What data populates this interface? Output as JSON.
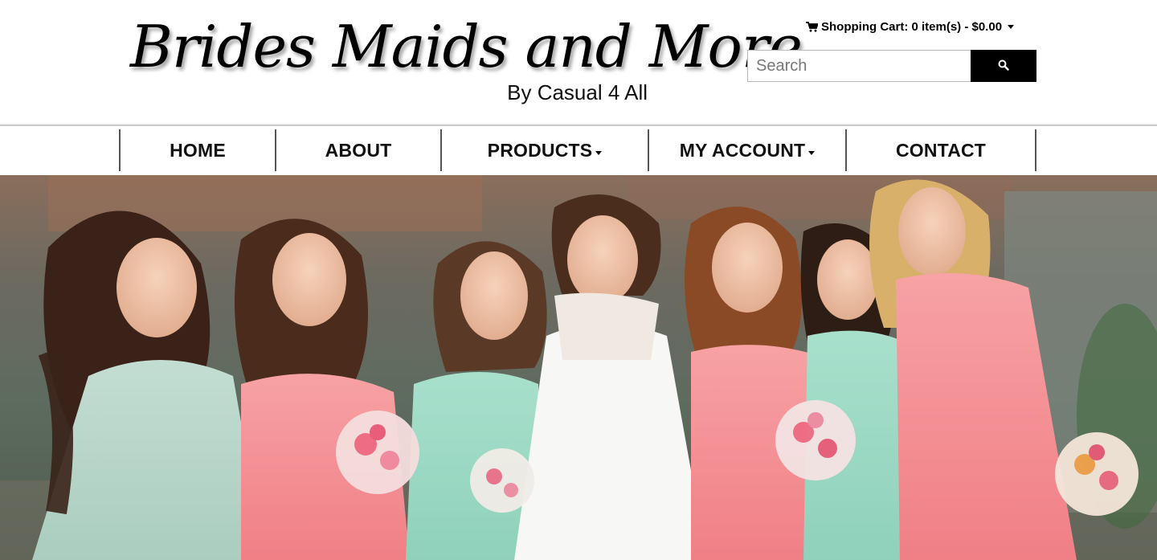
{
  "logo": {
    "title": "Brides Maids and More",
    "subtitle": "By Casual 4 All"
  },
  "cart": {
    "label": "Shopping Cart: 0 item(s) - $0.00",
    "icon": "shopping-cart-icon"
  },
  "search": {
    "placeholder": "Search",
    "value": "",
    "button_icon": "search-icon"
  },
  "nav": {
    "items": [
      {
        "label": "HOME",
        "has_dropdown": false
      },
      {
        "label": "ABOUT",
        "has_dropdown": false
      },
      {
        "label": "PRODUCTS",
        "has_dropdown": true
      },
      {
        "label": "MY ACCOUNT",
        "has_dropdown": true
      },
      {
        "label": "CONTACT",
        "has_dropdown": false
      }
    ]
  },
  "hero": {
    "description_colors": {
      "pink_dress": "#f58f93",
      "mint_dress": "#9fd9c4",
      "sage_dress": "#b9d9cc",
      "white_dress": "#f7f7f5",
      "wall": "#6f7a6e"
    }
  }
}
